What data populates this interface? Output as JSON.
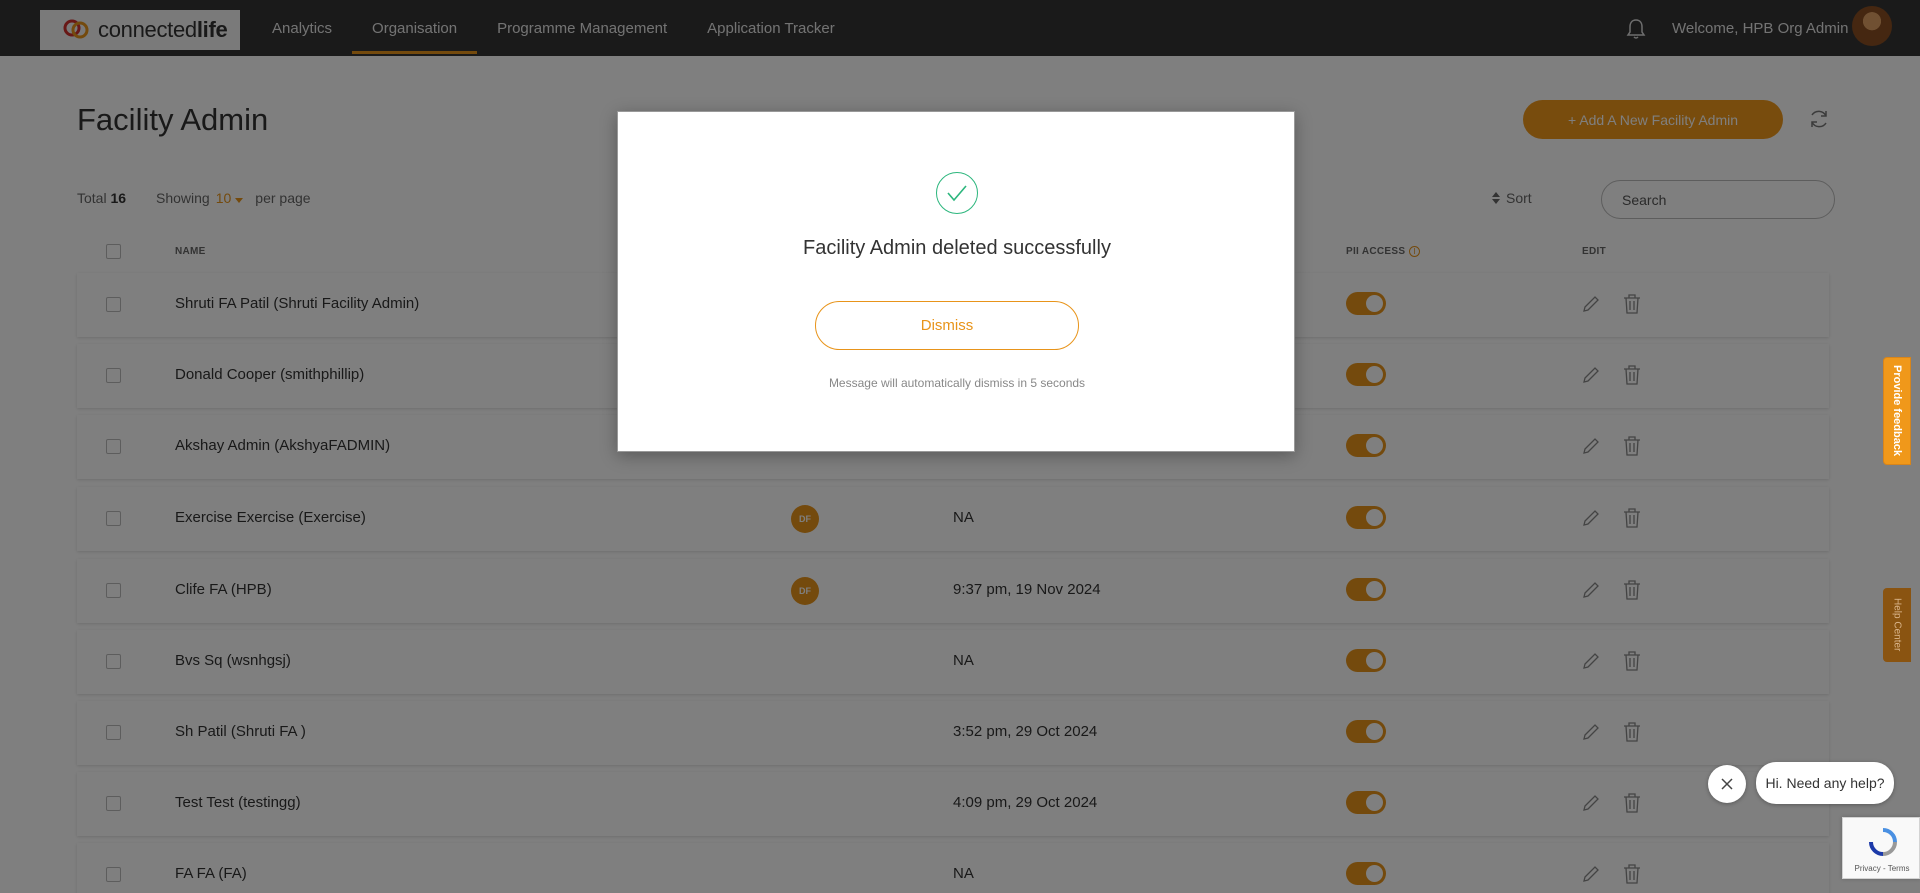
{
  "brand": {
    "logo_regular": "connected",
    "logo_bold": "life"
  },
  "nav": {
    "items": [
      {
        "label": "Analytics"
      },
      {
        "label": "Organisation",
        "active": true
      },
      {
        "label": "Programme Management"
      },
      {
        "label": "Application Tracker"
      }
    ],
    "welcome": "Welcome, HPB Org Admin"
  },
  "page": {
    "title": "Facility Admin",
    "add_button": "+ Add A New Facility Admin",
    "total_label": "Total",
    "total_count": "16",
    "showing_label": "Showing",
    "per_page_value": "10",
    "per_page_label": "per page",
    "sort_label": "Sort",
    "search_placeholder": "Search"
  },
  "table": {
    "headers": {
      "name": "NAME",
      "pii_access": "PII ACCESS",
      "edit": "EDIT"
    },
    "rows": [
      {
        "name": "Shruti FA Patil (Shruti Facility Admin)",
        "badge": "",
        "last_login": "",
        "pii": true
      },
      {
        "name": "Donald Cooper (smithphillip)",
        "badge": "",
        "last_login": "",
        "pii": true
      },
      {
        "name": "Akshay Admin (AkshyaFADMIN)",
        "badge": "",
        "last_login": "",
        "pii": true
      },
      {
        "name": "Exercise Exercise (Exercise)",
        "badge": "DF",
        "last_login": "NA",
        "pii": true
      },
      {
        "name": "Clife FA (HPB)",
        "badge": "DF",
        "last_login": "9:37 pm, 19 Nov 2024",
        "pii": true
      },
      {
        "name": "Bvs Sq (wsnhgsj)",
        "badge": "",
        "last_login": "NA",
        "pii": true
      },
      {
        "name": "Sh Patil (Shruti FA )",
        "badge": "",
        "last_login": "3:52 pm, 29 Oct 2024",
        "pii": true
      },
      {
        "name": "Test Test (testingg)",
        "badge": "",
        "last_login": "4:09 pm, 29 Oct 2024",
        "pii": true
      },
      {
        "name": "FA FA (FA)",
        "badge": "",
        "last_login": "NA",
        "pii": true
      }
    ]
  },
  "modal": {
    "message": "Facility Admin deleted successfully",
    "dismiss_label": "Dismiss",
    "auto_dismiss_text": "Message will automatically dismiss in 5 seconds"
  },
  "side_tabs": {
    "feedback": "Provide feedback",
    "help": "Help Center"
  },
  "chat": {
    "greeting": "Hi. Need any help?"
  },
  "recaptcha": {
    "text": "Privacy - Terms"
  },
  "colors": {
    "accent": "#e8941a",
    "topbar": "#353535",
    "success": "#2cb67d"
  },
  "icons": [
    "bell-icon",
    "refresh-icon",
    "sort-icon",
    "info-icon",
    "edit-icon",
    "trash-icon",
    "check-icon",
    "close-icon",
    "recaptcha-icon"
  ]
}
